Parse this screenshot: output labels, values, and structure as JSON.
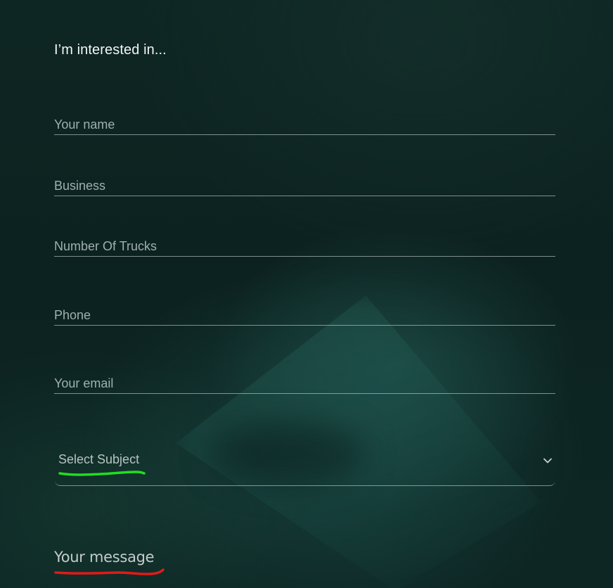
{
  "form": {
    "heading": "I’m interested in...",
    "fields": [
      {
        "name": "name",
        "placeholder": "Your name"
      },
      {
        "name": "business",
        "placeholder": "Business"
      },
      {
        "name": "trucks",
        "placeholder": "Number Of Trucks"
      },
      {
        "name": "phone",
        "placeholder": "Phone"
      },
      {
        "name": "email",
        "placeholder": "Your email"
      }
    ],
    "subject": {
      "selected": "Select Subject",
      "icon": "chevron-down-icon"
    },
    "message": {
      "placeholder": "Your message"
    }
  },
  "annotations": {
    "subject_underline_color": "#22dd22",
    "message_underline_color": "#e11a1a"
  },
  "colors": {
    "background": "#0d2422",
    "text": "#f2f6f5",
    "placeholder": "#9fb0ad",
    "line": "#c8d7d4"
  }
}
